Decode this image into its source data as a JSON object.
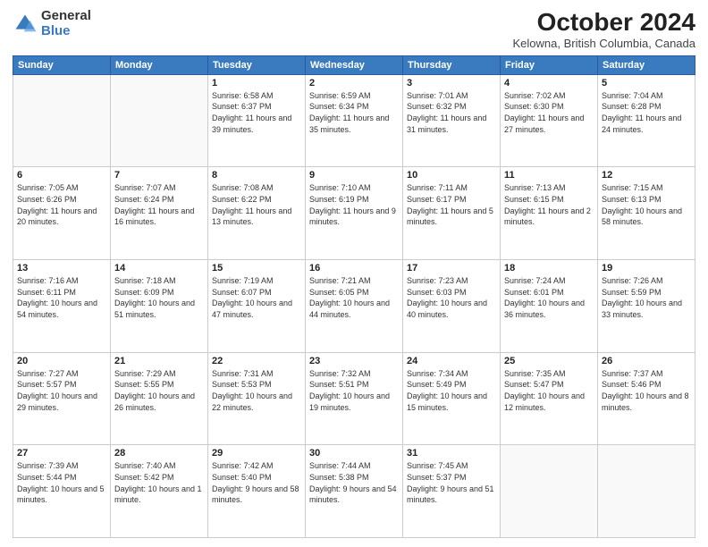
{
  "logo": {
    "general": "General",
    "blue": "Blue"
  },
  "title": "October 2024",
  "location": "Kelowna, British Columbia, Canada",
  "days_header": [
    "Sunday",
    "Monday",
    "Tuesday",
    "Wednesday",
    "Thursday",
    "Friday",
    "Saturday"
  ],
  "weeks": [
    [
      {
        "day": "",
        "info": ""
      },
      {
        "day": "",
        "info": ""
      },
      {
        "day": "1",
        "info": "Sunrise: 6:58 AM\nSunset: 6:37 PM\nDaylight: 11 hours and 39 minutes."
      },
      {
        "day": "2",
        "info": "Sunrise: 6:59 AM\nSunset: 6:34 PM\nDaylight: 11 hours and 35 minutes."
      },
      {
        "day": "3",
        "info": "Sunrise: 7:01 AM\nSunset: 6:32 PM\nDaylight: 11 hours and 31 minutes."
      },
      {
        "day": "4",
        "info": "Sunrise: 7:02 AM\nSunset: 6:30 PM\nDaylight: 11 hours and 27 minutes."
      },
      {
        "day": "5",
        "info": "Sunrise: 7:04 AM\nSunset: 6:28 PM\nDaylight: 11 hours and 24 minutes."
      }
    ],
    [
      {
        "day": "6",
        "info": "Sunrise: 7:05 AM\nSunset: 6:26 PM\nDaylight: 11 hours and 20 minutes."
      },
      {
        "day": "7",
        "info": "Sunrise: 7:07 AM\nSunset: 6:24 PM\nDaylight: 11 hours and 16 minutes."
      },
      {
        "day": "8",
        "info": "Sunrise: 7:08 AM\nSunset: 6:22 PM\nDaylight: 11 hours and 13 minutes."
      },
      {
        "day": "9",
        "info": "Sunrise: 7:10 AM\nSunset: 6:19 PM\nDaylight: 11 hours and 9 minutes."
      },
      {
        "day": "10",
        "info": "Sunrise: 7:11 AM\nSunset: 6:17 PM\nDaylight: 11 hours and 5 minutes."
      },
      {
        "day": "11",
        "info": "Sunrise: 7:13 AM\nSunset: 6:15 PM\nDaylight: 11 hours and 2 minutes."
      },
      {
        "day": "12",
        "info": "Sunrise: 7:15 AM\nSunset: 6:13 PM\nDaylight: 10 hours and 58 minutes."
      }
    ],
    [
      {
        "day": "13",
        "info": "Sunrise: 7:16 AM\nSunset: 6:11 PM\nDaylight: 10 hours and 54 minutes."
      },
      {
        "day": "14",
        "info": "Sunrise: 7:18 AM\nSunset: 6:09 PM\nDaylight: 10 hours and 51 minutes."
      },
      {
        "day": "15",
        "info": "Sunrise: 7:19 AM\nSunset: 6:07 PM\nDaylight: 10 hours and 47 minutes."
      },
      {
        "day": "16",
        "info": "Sunrise: 7:21 AM\nSunset: 6:05 PM\nDaylight: 10 hours and 44 minutes."
      },
      {
        "day": "17",
        "info": "Sunrise: 7:23 AM\nSunset: 6:03 PM\nDaylight: 10 hours and 40 minutes."
      },
      {
        "day": "18",
        "info": "Sunrise: 7:24 AM\nSunset: 6:01 PM\nDaylight: 10 hours and 36 minutes."
      },
      {
        "day": "19",
        "info": "Sunrise: 7:26 AM\nSunset: 5:59 PM\nDaylight: 10 hours and 33 minutes."
      }
    ],
    [
      {
        "day": "20",
        "info": "Sunrise: 7:27 AM\nSunset: 5:57 PM\nDaylight: 10 hours and 29 minutes."
      },
      {
        "day": "21",
        "info": "Sunrise: 7:29 AM\nSunset: 5:55 PM\nDaylight: 10 hours and 26 minutes."
      },
      {
        "day": "22",
        "info": "Sunrise: 7:31 AM\nSunset: 5:53 PM\nDaylight: 10 hours and 22 minutes."
      },
      {
        "day": "23",
        "info": "Sunrise: 7:32 AM\nSunset: 5:51 PM\nDaylight: 10 hours and 19 minutes."
      },
      {
        "day": "24",
        "info": "Sunrise: 7:34 AM\nSunset: 5:49 PM\nDaylight: 10 hours and 15 minutes."
      },
      {
        "day": "25",
        "info": "Sunrise: 7:35 AM\nSunset: 5:47 PM\nDaylight: 10 hours and 12 minutes."
      },
      {
        "day": "26",
        "info": "Sunrise: 7:37 AM\nSunset: 5:46 PM\nDaylight: 10 hours and 8 minutes."
      }
    ],
    [
      {
        "day": "27",
        "info": "Sunrise: 7:39 AM\nSunset: 5:44 PM\nDaylight: 10 hours and 5 minutes."
      },
      {
        "day": "28",
        "info": "Sunrise: 7:40 AM\nSunset: 5:42 PM\nDaylight: 10 hours and 1 minute."
      },
      {
        "day": "29",
        "info": "Sunrise: 7:42 AM\nSunset: 5:40 PM\nDaylight: 9 hours and 58 minutes."
      },
      {
        "day": "30",
        "info": "Sunrise: 7:44 AM\nSunset: 5:38 PM\nDaylight: 9 hours and 54 minutes."
      },
      {
        "day": "31",
        "info": "Sunrise: 7:45 AM\nSunset: 5:37 PM\nDaylight: 9 hours and 51 minutes."
      },
      {
        "day": "",
        "info": ""
      },
      {
        "day": "",
        "info": ""
      }
    ]
  ]
}
